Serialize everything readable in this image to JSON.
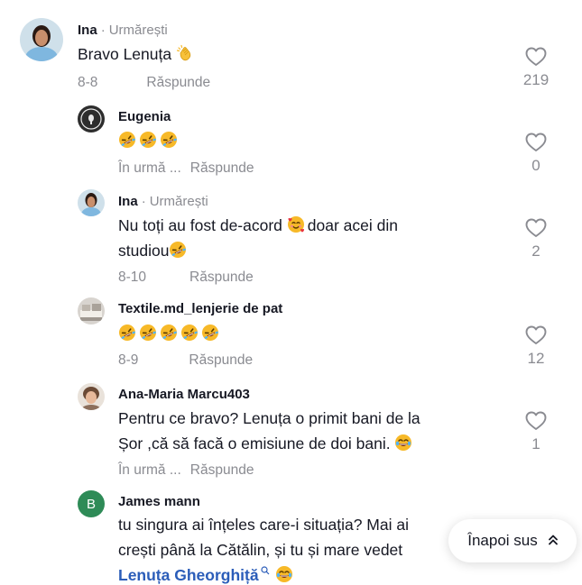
{
  "comments": [
    {
      "author": "Ina",
      "follow": "Urmărești",
      "text": "Bravo Lenuța",
      "emoji": "clap",
      "date": "8-8",
      "reply": "Răspunde",
      "likes": "219"
    },
    {
      "author": "Eugenia",
      "text": "🤣🤣🤣",
      "date": "În urmă ...",
      "reply": "Răspunde",
      "likes": "0"
    },
    {
      "author": "Ina",
      "follow": "Urmărești",
      "text_part1": "Nu toți au fost de-acord",
      "text_part2": "doar acei din",
      "text_part3": "studiou",
      "date": "8-10",
      "reply": "Răspunde",
      "likes": "2"
    },
    {
      "author": "Textile.md_lenjerie de pat",
      "text": "🤣🤣🤣🤣🤣",
      "date": "8-9",
      "reply": "Răspunde",
      "likes": "12"
    },
    {
      "author": "Ana-Maria Marcu403",
      "text_line1": "Pentru ce bravo? Lenuța o primit bani de la",
      "text_line2": "Șor ,că să facă o emisiune de doi bani.",
      "date": "În urmă ...",
      "reply": "Răspunde",
      "likes": "1"
    },
    {
      "author": "James mann",
      "avatar_letter": "B",
      "text_line1": "tu singura ai înțeles care-i situația? Mai ai",
      "text_line2": "crești până la Cătălin, și tu și mare vedet",
      "mention": "Lenuța Gheorghiță"
    }
  ],
  "back_to_top": "Înapoi sus",
  "colors": {
    "text": "#161823",
    "muted": "#8a8b91",
    "mention": "#2b5db9",
    "avatar_green": "#2e8b57"
  },
  "icons": [
    "heart-outline-icon",
    "clap-emoji",
    "rofl-emoji",
    "smiling-hearts-emoji",
    "joy-emoji",
    "search-icon",
    "double-chevron-up-icon"
  ]
}
